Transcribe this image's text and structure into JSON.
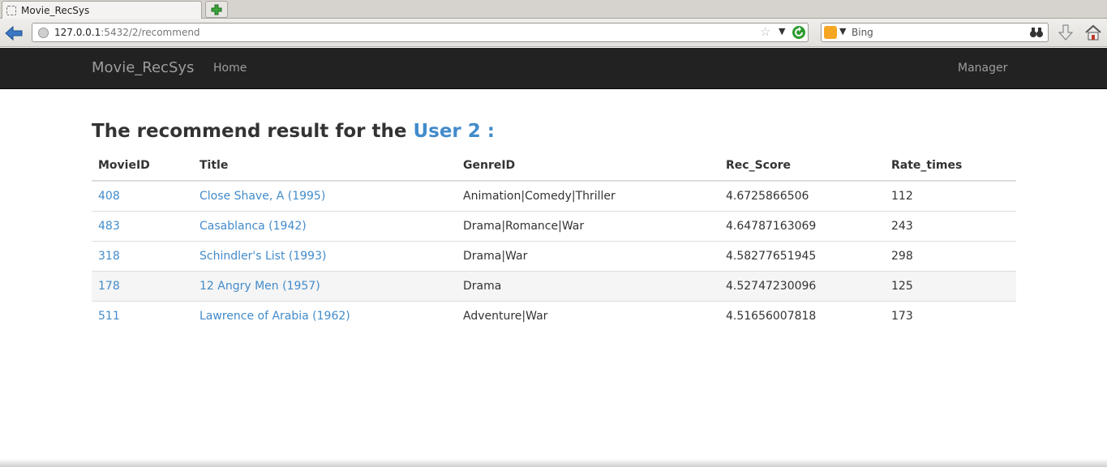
{
  "browser": {
    "tab_title": "Movie_RecSys",
    "url_host": "127.0.0.1",
    "url_rest": ":5432/2/recommend",
    "search_placeholder": "Bing"
  },
  "nav": {
    "brand": "Movie_RecSys",
    "home": "Home",
    "manager": "Manager"
  },
  "page": {
    "heading_prefix": "The recommend result for the ",
    "heading_user": "User 2 :"
  },
  "table": {
    "headers": [
      "MovieID",
      "Title",
      "GenreID",
      "Rec_Score",
      "Rate_times"
    ],
    "rows": [
      {
        "id": "408",
        "title": "Close Shave, A (1995)",
        "genre": "Animation|Comedy|Thriller",
        "score": "4.6725866506",
        "rates": "112"
      },
      {
        "id": "483",
        "title": "Casablanca (1942)",
        "genre": "Drama|Romance|War",
        "score": "4.64787163069",
        "rates": "243"
      },
      {
        "id": "318",
        "title": "Schindler's List (1993)",
        "genre": "Drama|War",
        "score": "4.58277651945",
        "rates": "298"
      },
      {
        "id": "178",
        "title": "12 Angry Men (1957)",
        "genre": "Drama",
        "score": "4.52747230096",
        "rates": "125"
      },
      {
        "id": "511",
        "title": "Lawrence of Arabia (1962)",
        "genre": "Adventure|War",
        "score": "4.51656007818",
        "rates": "173"
      }
    ]
  },
  "colors": {
    "link": "#428bca",
    "navbar_bg": "#222222",
    "navbar_text": "#9d9d9d"
  }
}
